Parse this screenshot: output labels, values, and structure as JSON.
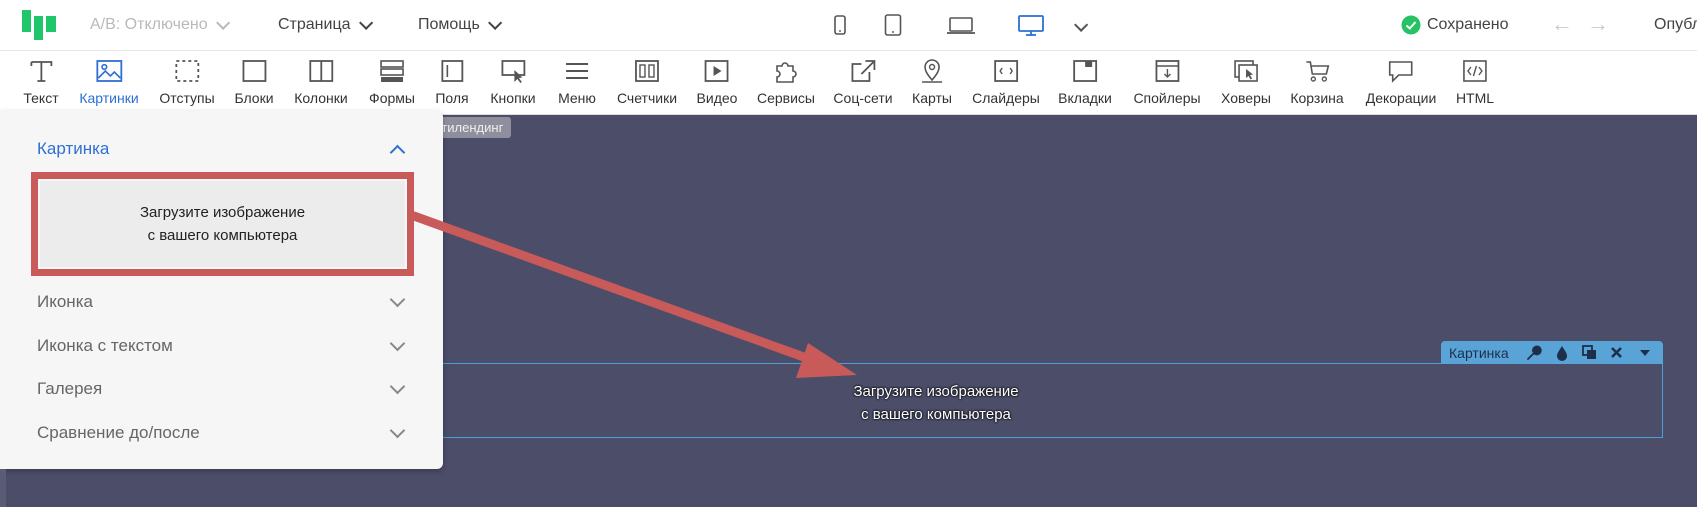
{
  "colors": {
    "accent": "#2f6fd3",
    "logo": "#1fc66b",
    "annotation_red": "#c85a5a",
    "canvas_bg": "#4b4d69",
    "block_blue": "#5aa3d6"
  },
  "topbar": {
    "ab_label": "A/B: Отключено",
    "page_label": "Страница",
    "help_label": "Помощь",
    "saved_label": "Сохранено",
    "publish_label": "Опубл",
    "devices": [
      "phone-icon",
      "tablet-icon",
      "laptop-icon",
      "desktop-icon"
    ],
    "active_device": "desktop-icon"
  },
  "toolbar": {
    "active": "Картинки",
    "items": [
      {
        "label": "Текст",
        "icon": "text-icon"
      },
      {
        "label": "Картинки",
        "icon": "image-icon"
      },
      {
        "label": "Отступы",
        "icon": "spacing-icon"
      },
      {
        "label": "Блоки",
        "icon": "block-icon"
      },
      {
        "label": "Колонки",
        "icon": "columns-icon"
      },
      {
        "label": "Формы",
        "icon": "forms-icon"
      },
      {
        "label": "Поля",
        "icon": "fields-icon"
      },
      {
        "label": "Кнопки",
        "icon": "button-icon"
      },
      {
        "label": "Меню",
        "icon": "menu-icon"
      },
      {
        "label": "Счетчики",
        "icon": "counter-icon"
      },
      {
        "label": "Видео",
        "icon": "video-icon"
      },
      {
        "label": "Сервисы",
        "icon": "puzzle-icon"
      },
      {
        "label": "Соц-сети",
        "icon": "share-icon"
      },
      {
        "label": "Карты",
        "icon": "map-pin-icon"
      },
      {
        "label": "Слайдеры",
        "icon": "slider-icon"
      },
      {
        "label": "Вкладки",
        "icon": "tabs-icon"
      },
      {
        "label": "Спойлеры",
        "icon": "spoiler-icon"
      },
      {
        "label": "Ховеры",
        "icon": "hover-icon"
      },
      {
        "label": "Корзина",
        "icon": "cart-icon"
      },
      {
        "label": "Декорации",
        "icon": "decoration-icon"
      },
      {
        "label": "HTML",
        "icon": "code-icon"
      }
    ]
  },
  "canvas": {
    "tag_label": "льтилендинг"
  },
  "side_panel": {
    "open_section": "Картинка",
    "upload_text_line1": "Загрузите изображение",
    "upload_text_line2": "с вашего компьютера",
    "sections": [
      "Иконка",
      "Иконка с текстом",
      "Галерея",
      "Сравнение до/после"
    ]
  },
  "block": {
    "bar_label": "Картинка",
    "bar_icons": [
      "wrench-icon",
      "drop-icon",
      "copy-icon",
      "close-icon",
      "caret-down-icon"
    ],
    "text_line1": "Загрузите изображение",
    "text_line2": "с вашего компьютера"
  }
}
